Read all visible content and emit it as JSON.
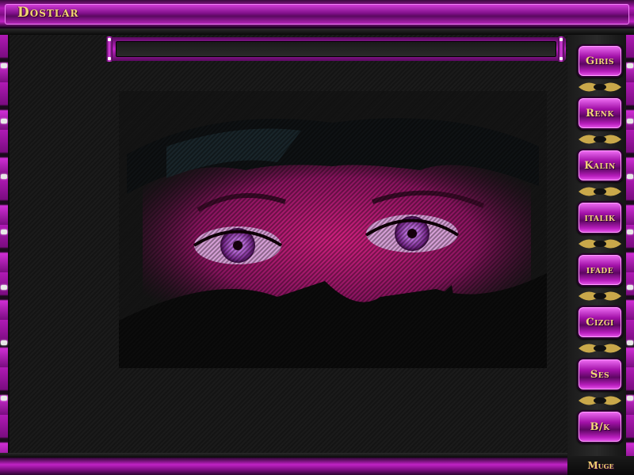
{
  "window": {
    "title": "Dostlar"
  },
  "message_input": {
    "value": "",
    "placeholder": ""
  },
  "nav_buttons": [
    {
      "label": "Giris"
    },
    {
      "label": "Renk"
    },
    {
      "label": "Kalin"
    },
    {
      "label": "italik"
    },
    {
      "label": "ifade"
    },
    {
      "label": "Cizgi"
    },
    {
      "label": "Ses"
    },
    {
      "label": "B/k"
    }
  ],
  "footer": {
    "credit": "Muge"
  },
  "colors": {
    "accent": "#b31ab8",
    "text_gold": "#f2d472",
    "background": "#141414"
  },
  "image": {
    "subject": "woman-eyes-artwork"
  }
}
